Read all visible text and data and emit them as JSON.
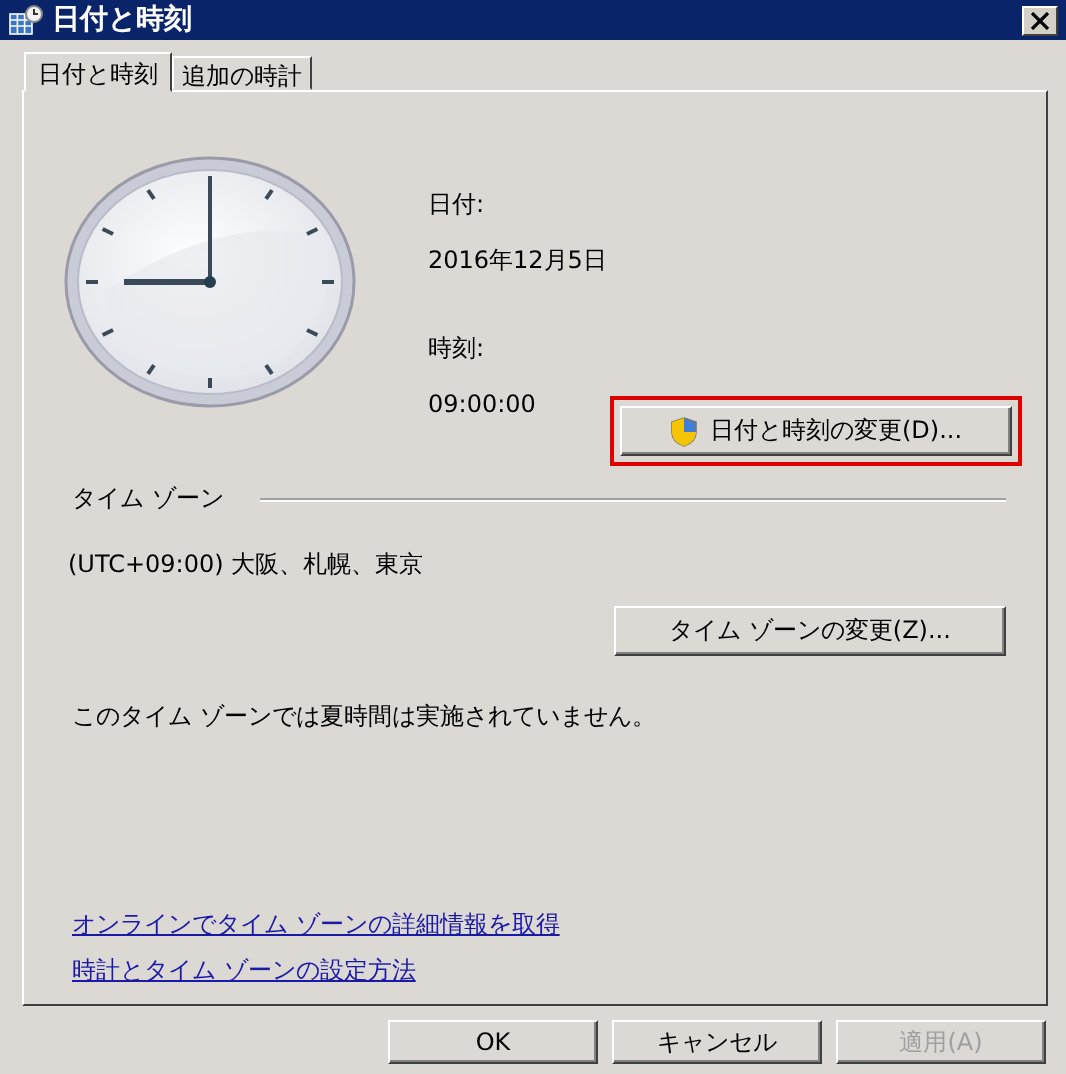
{
  "window": {
    "title": "日付と時刻"
  },
  "tabs": [
    {
      "label": "日付と時刻",
      "selected": true
    },
    {
      "label": "追加の時計",
      "selected": false
    }
  ],
  "date": {
    "label": "日付:",
    "value": "2016年12月5日"
  },
  "time": {
    "label": "時刻:",
    "value": "09:00:00"
  },
  "change_datetime_button": {
    "label": "日付と時刻の変更(D)...",
    "highlighted": true
  },
  "time_zone": {
    "heading": "タイム ゾーン",
    "value": "(UTC+09:00) 大阪、札幌、東京",
    "button": "タイム ゾーンの変更(Z)...",
    "note": "このタイム ゾーンでは夏時間は実施されていません。"
  },
  "links": [
    "オンラインでタイム ゾーンの詳細情報を取得",
    "時計とタイム ゾーンの設定方法"
  ],
  "buttons": [
    {
      "label": "OK",
      "disabled": false
    },
    {
      "label": "キャンセル",
      "disabled": false
    },
    {
      "label": "適用(A)",
      "disabled": true
    }
  ]
}
